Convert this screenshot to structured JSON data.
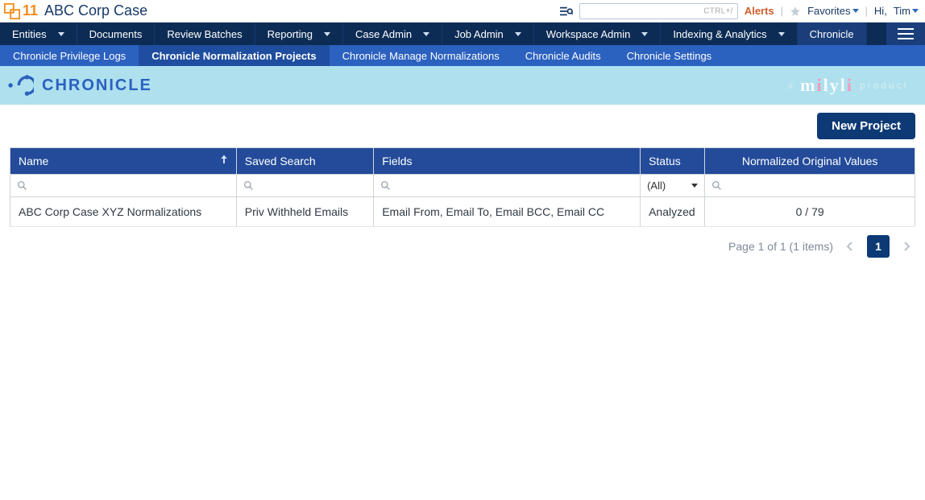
{
  "topbar": {
    "logo_num": "11",
    "case_title": "ABC Corp Case",
    "search_placeholder": "",
    "search_shortcut": "CTRL+/",
    "alerts": "Alerts",
    "favorites": "Favorites",
    "hi": "Hi,",
    "user": "Tim"
  },
  "nav": {
    "entities": "Entities",
    "documents": "Documents",
    "review_batches": "Review Batches",
    "reporting": "Reporting",
    "case_admin": "Case Admin",
    "job_admin": "Job Admin",
    "workspace_admin": "Workspace Admin",
    "indexing_analytics": "Indexing & Analytics",
    "chronicle": "Chronicle"
  },
  "subnav": {
    "privilege_logs": "Chronicle Privilege Logs",
    "normalization_projects": "Chronicle Normalization Projects",
    "manage_normalizations": "Chronicle Manage Normalizations",
    "audits": "Chronicle Audits",
    "settings": "Chronicle Settings"
  },
  "banner": {
    "chronicle_word": "CHRONICLE",
    "a_text": "a",
    "milyli": "milyli",
    "product": "product"
  },
  "actions": {
    "new_project": "New Project"
  },
  "table": {
    "columns": {
      "name": "Name",
      "saved_search": "Saved Search",
      "fields": "Fields",
      "status": "Status",
      "nov": "Normalized Original Values"
    },
    "filters": {
      "status_all": "(All)"
    },
    "rows": [
      {
        "name": "ABC Corp Case XYZ Normalizations",
        "saved_search": "Priv Withheld Emails",
        "fields": "Email From, Email To, Email BCC, Email CC",
        "status": "Analyzed",
        "nov": "0 / 79"
      }
    ]
  },
  "pagination": {
    "summary": "Page 1 of 1 (1 items)",
    "current": "1"
  }
}
